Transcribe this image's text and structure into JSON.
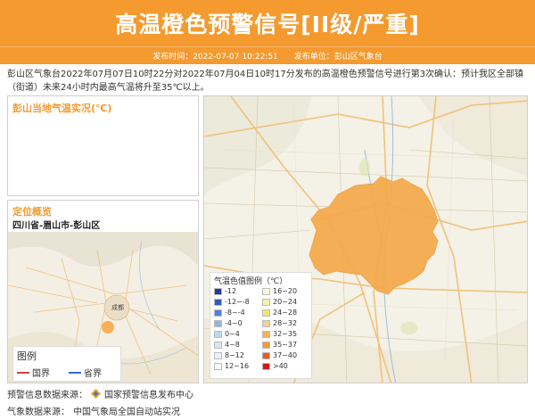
{
  "banner": {
    "title": "高温橙色预警信号[II级/严重]",
    "color": "#f49a2f"
  },
  "publish": {
    "time_label": "发布时间：2022-07-07 10:22:51",
    "unit_label": "发布单位：彭山区气象台"
  },
  "description": "彭山区气象台2022年07月07日10时22分对2022年07月04日10时17分发布的高温橙色预警信号进行第3次确认：预计我区全部镇（街道）未来24小时内最高气温将升至35℃以上。",
  "temp_panel": {
    "title": "彭山当地气温实况(℃)"
  },
  "location_panel": {
    "title": "定位概览",
    "region": "四川省-眉山市-彭山区",
    "map_city_label": "成都",
    "legend": {
      "title": "图例",
      "items": [
        {
          "label": "国界",
          "color": "#cc4444"
        },
        {
          "label": "省界",
          "color": "#2f6be0"
        }
      ]
    }
  },
  "temp_legend": {
    "title": "气温色值图例（℃）",
    "items": [
      {
        "label": "-12",
        "color": "#1c3f8f"
      },
      {
        "label": "16~20",
        "color": "#fbfbd6"
      },
      {
        "label": "-12~-8",
        "color": "#2d5db5"
      },
      {
        "label": "20~24",
        "color": "#f6f2a8"
      },
      {
        "label": "-8~-4",
        "color": "#4d82d4"
      },
      {
        "label": "24~28",
        "color": "#f1e37a"
      },
      {
        "label": "-4~0",
        "color": "#8fb6ea"
      },
      {
        "label": "28~32",
        "color": "#f7d08a"
      },
      {
        "label": "0~4",
        "color": "#bcd6f3"
      },
      {
        "label": "32~35",
        "color": "#f5b157"
      },
      {
        "label": "4~8",
        "color": "#d6e7f7"
      },
      {
        "label": "35~37",
        "color": "#f59a39"
      },
      {
        "label": "8~12",
        "color": "#e8f2fb"
      },
      {
        "label": "37~40",
        "color": "#e85a1e"
      },
      {
        "label": "12~16",
        "color": "#f5f9f0"
      },
      {
        "label": ">40",
        "color": "#d2161a"
      }
    ]
  },
  "sources": {
    "warning_label": "预警信息数据来源：",
    "warning_value": "国家预警信息发布中心",
    "weather_label": "气象数据来源：",
    "weather_value": "中国气象局全国自动站实况"
  }
}
